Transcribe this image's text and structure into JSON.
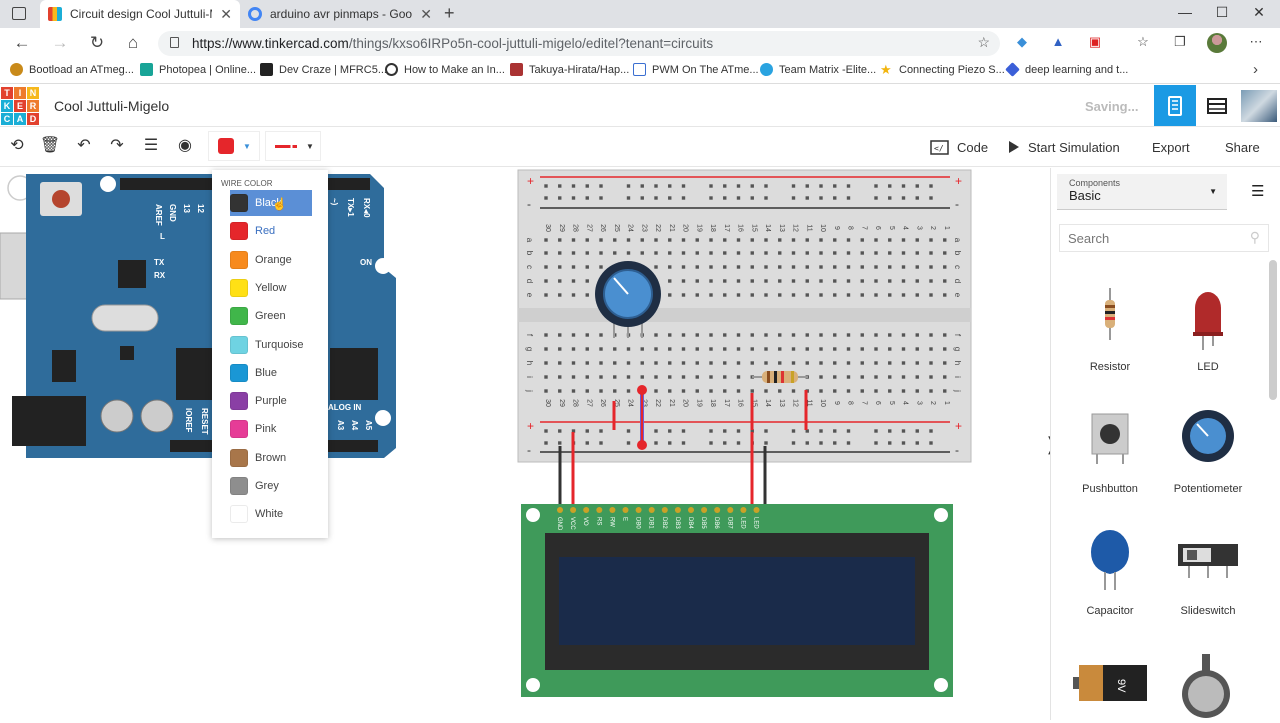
{
  "browser": {
    "tabs": [
      {
        "title": "Circuit design Cool Juttuli-Migel",
        "favicon_color": "#e2412e",
        "active": true
      },
      {
        "title": "arduino avr pinmaps - Google S",
        "favicon_color": "#4285f4",
        "active": false
      }
    ],
    "url_host": "https://www.tinkercad.com",
    "url_path": "/things/kxso6IRPo5n-cool-juttuli-migelo/editel?tenant=circuits",
    "bookmarks": [
      "Bootload an ATmeg...",
      "Photopea | Online...",
      "Dev Craze | MFRC5...",
      "How to Make an In...",
      "Takuya-Hirata/Hap...",
      "PWM On The ATme...",
      "Team Matrix -Elite...",
      "Connecting Piezo S...",
      "deep learning and t..."
    ]
  },
  "app": {
    "logo": [
      "T",
      "I",
      "N",
      "K",
      "E",
      "R",
      "C",
      "A",
      "D"
    ],
    "logo_colors": [
      "#e2412e",
      "#ee7b2c",
      "#f6b81c",
      "#1baed6",
      "#e2412e",
      "#ee7b2c",
      "#1baed6",
      "#1baed6",
      "#e2412e"
    ],
    "title": "Cool Juttuli-Migelo",
    "status": "Saving..."
  },
  "toolbar": {
    "code": "Code",
    "start": "Start Simulation",
    "export": "Export",
    "share": "Share",
    "wire_color": "#e5262b"
  },
  "wire_menu": {
    "header": "WIRE COLOR",
    "colors": [
      {
        "name": "Black",
        "hex": "#333333",
        "selected": true
      },
      {
        "name": "Red",
        "hex": "#e5262b"
      },
      {
        "name": "Orange",
        "hex": "#f78a1d"
      },
      {
        "name": "Yellow",
        "hex": "#ffe015"
      },
      {
        "name": "Green",
        "hex": "#40b64a"
      },
      {
        "name": "Turquoise",
        "hex": "#6fd3e2"
      },
      {
        "name": "Blue",
        "hex": "#1a97d5"
      },
      {
        "name": "Purple",
        "hex": "#8a3fa5"
      },
      {
        "name": "Pink",
        "hex": "#e63c97"
      },
      {
        "name": "Brown",
        "hex": "#a8764a"
      },
      {
        "name": "Grey",
        "hex": "#8e8e8e"
      },
      {
        "name": "White",
        "hex": "#ffffff"
      }
    ]
  },
  "components_panel": {
    "label": "Components",
    "value": "Basic",
    "search_placeholder": "Search",
    "items": [
      "Resistor",
      "LED",
      "Pushbutton",
      "Potentiometer",
      "Capacitor",
      "Slideswitch"
    ]
  },
  "board": {
    "arduino_labels": [
      "AREF",
      "GND",
      "13",
      "12",
      "11",
      "TX",
      "RX",
      "L",
      "ON",
      "IOREF",
      "RESET",
      "ALOG IN",
      "A3",
      "A4",
      "A5",
      "~)",
      "TX▸1",
      "RX◂0"
    ],
    "lcd_pins": [
      "GND",
      "VCC",
      "VO",
      "RS",
      "RW",
      "E",
      "DB0",
      "DB1",
      "DB2",
      "DB3",
      "DB4",
      "DB5",
      "DB6",
      "DB7",
      "LED",
      "LED"
    ],
    "bb_cols": [
      "30",
      "29",
      "28",
      "27",
      "26",
      "25",
      "24",
      "23",
      "22",
      "21",
      "20",
      "19",
      "18",
      "17",
      "16",
      "15",
      "14",
      "13",
      "12",
      "11",
      "10",
      "9",
      "8",
      "7",
      "6",
      "5",
      "4",
      "3",
      "2",
      "1"
    ],
    "bb_rows_top": [
      "a",
      "b",
      "c",
      "d",
      "e"
    ],
    "bb_rows_bot": [
      "f",
      "g",
      "h",
      "i",
      "j"
    ]
  }
}
